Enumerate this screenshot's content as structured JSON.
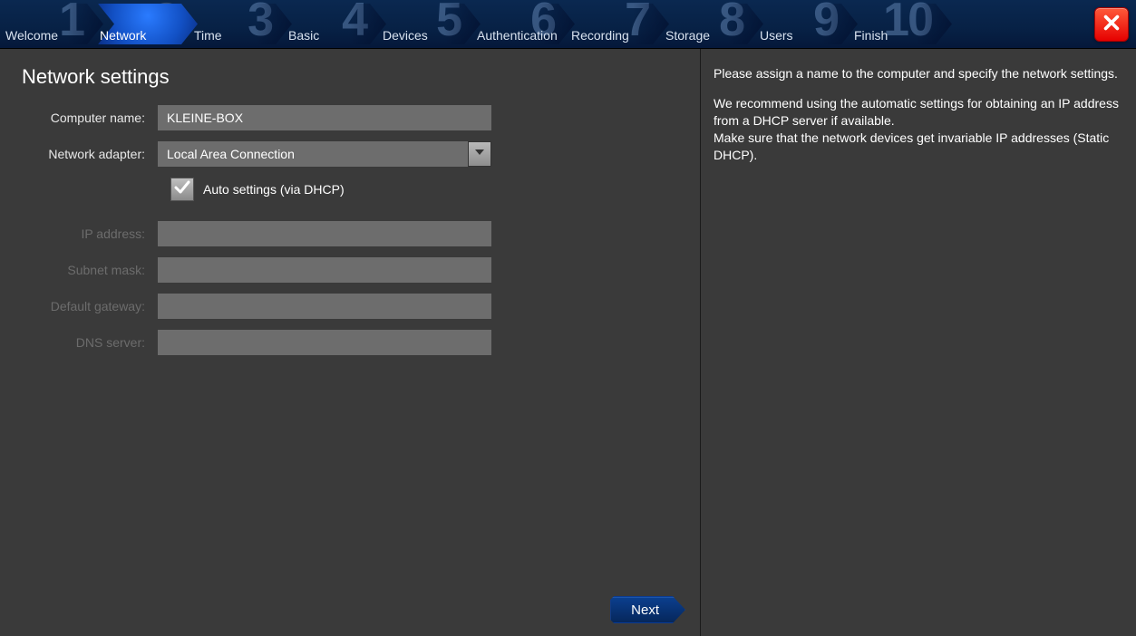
{
  "wizard": {
    "steps": [
      {
        "num": "1",
        "label": "Welcome"
      },
      {
        "num": "2",
        "label": "Network"
      },
      {
        "num": "3",
        "label": "Time"
      },
      {
        "num": "4",
        "label": "Basic"
      },
      {
        "num": "5",
        "label": "Devices"
      },
      {
        "num": "6",
        "label": "Authentication"
      },
      {
        "num": "7",
        "label": "Recording"
      },
      {
        "num": "8",
        "label": "Storage"
      },
      {
        "num": "9",
        "label": "Users"
      },
      {
        "num": "10",
        "label": "Finish"
      }
    ],
    "active_index": 1
  },
  "page": {
    "title": "Network settings",
    "next_label": "Next"
  },
  "form": {
    "computer_name_label": "Computer name:",
    "computer_name_value": "KLEINE-BOX",
    "network_adapter_label": "Network adapter:",
    "network_adapter_value": "Local Area Connection",
    "auto_settings_label": "Auto settings (via DHCP)",
    "auto_settings_checked": true,
    "ip_address_label": "IP address:",
    "ip_address_value": "",
    "subnet_mask_label": "Subnet mask:",
    "subnet_mask_value": "",
    "default_gateway_label": "Default gateway:",
    "default_gateway_value": "",
    "dns_server_label": "DNS server:",
    "dns_server_value": ""
  },
  "help": {
    "p1": "Please assign a name to the computer and specify the network settings.",
    "p2": "We recommend using the automatic settings for obtaining an IP address from a DHCP server if available.",
    "p3": "Make sure that the network devices get invariable IP addresses (Static DHCP)."
  }
}
